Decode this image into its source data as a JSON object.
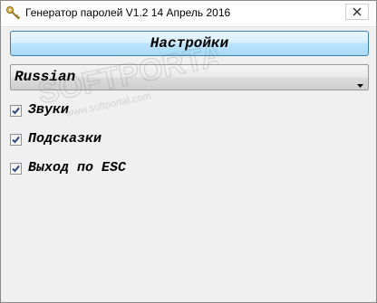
{
  "window": {
    "title": "Генератор паролей  V1.2  14 Апрель 2016",
    "icon": "key-icon"
  },
  "toolbar": {
    "settings_label": "Настройки"
  },
  "language": {
    "selected": "Russian"
  },
  "options": [
    {
      "label": "Звуки",
      "checked": true
    },
    {
      "label": "Подсказки",
      "checked": true
    },
    {
      "label": "Выход по ESC",
      "checked": true
    }
  ],
  "watermark": {
    "text": "SOFTPORTAL",
    "url": "www.softportal.com"
  },
  "colors": {
    "button_border": "#3c7fb1",
    "button_fill": "#bee6fd",
    "window_bg": "#f0f0f0"
  }
}
